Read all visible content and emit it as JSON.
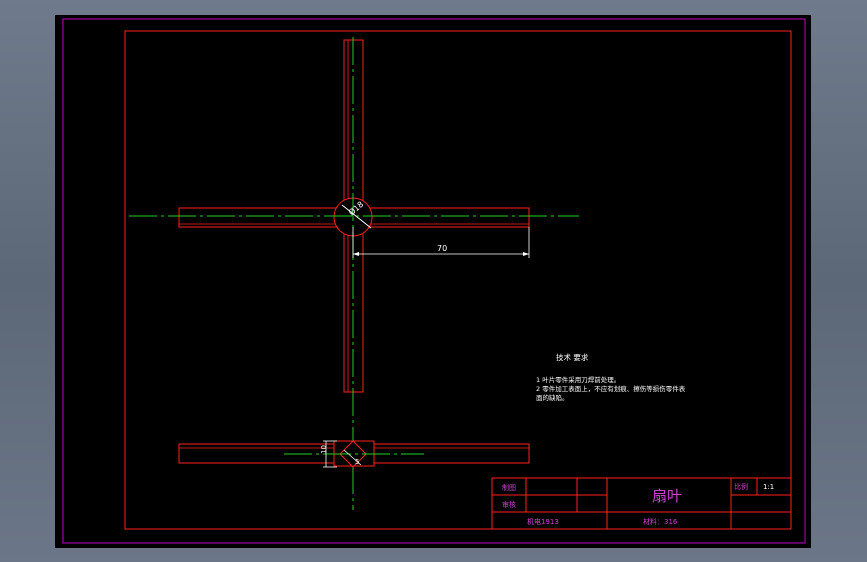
{
  "drawing": {
    "dimensions": {
      "diameter": "Ø18",
      "blade_length": "70",
      "section_width": "10",
      "section_small": "5"
    },
    "notes": {
      "heading": "技术 要求",
      "line1": "1 叶片零件采用刀焊前处理。",
      "line2": "2 零件加工表面上，不应有划痕、擦伤等损伤零件表",
      "line3": "面的缺陷。"
    },
    "title_block": {
      "part_name": "扇叶",
      "drawn_label": "制图",
      "check_label": "审核",
      "scale_label": "比例",
      "scale_value": "1:1",
      "class_label": "机电1913",
      "material_label": "材料：316"
    }
  },
  "colors": {
    "frame_magenta": "#c000c0",
    "outline_red": "#ff2020",
    "centerline_green": "#20d020",
    "dimension_white": "#ffffff",
    "title_text_magenta": "#d040d0"
  }
}
